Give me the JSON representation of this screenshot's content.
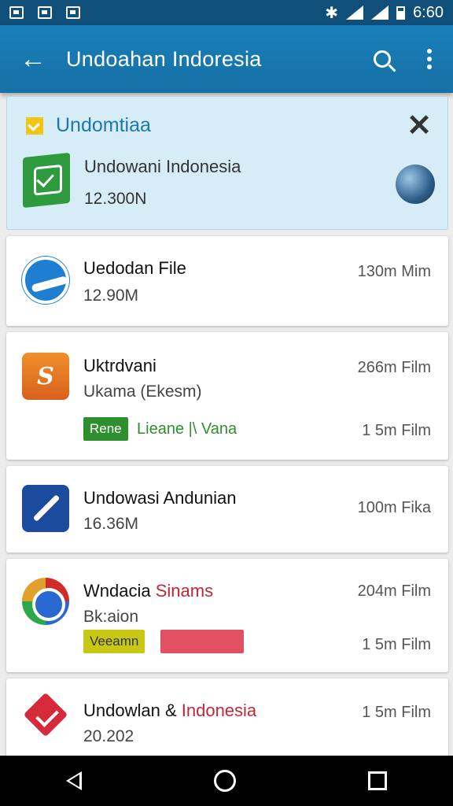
{
  "status_bar": {
    "time": "6:60"
  },
  "app_bar": {
    "title": "Undoahan Indoresia"
  },
  "banner": {
    "title": "Undomtiaa",
    "app_name": "Undowani Indonesia",
    "size": "12.300N"
  },
  "items": [
    {
      "name": "Uedodan File",
      "sub": "12.90M",
      "meta": "130m Mim"
    },
    {
      "name": "Uktrdvani",
      "sub": "Ukama (Ekesm)",
      "meta": "266m Film",
      "badge": "Rene",
      "badge_text": "Lieane |\\ Vana",
      "meta2": "1 5m Film"
    },
    {
      "name": "Undowasi Andunian",
      "sub": "16.36M",
      "meta": "100m Fika"
    },
    {
      "name_a": "Wndacia ",
      "name_b": "Sinams",
      "sub": "Bk:aion",
      "meta": "204m Film",
      "badge": "Veeamn",
      "meta2": "1 5m Film"
    },
    {
      "name_a": "Undowlan & ",
      "name_b": "Indonesia",
      "sub": "20.202",
      "meta": "1 5m Film"
    }
  ]
}
